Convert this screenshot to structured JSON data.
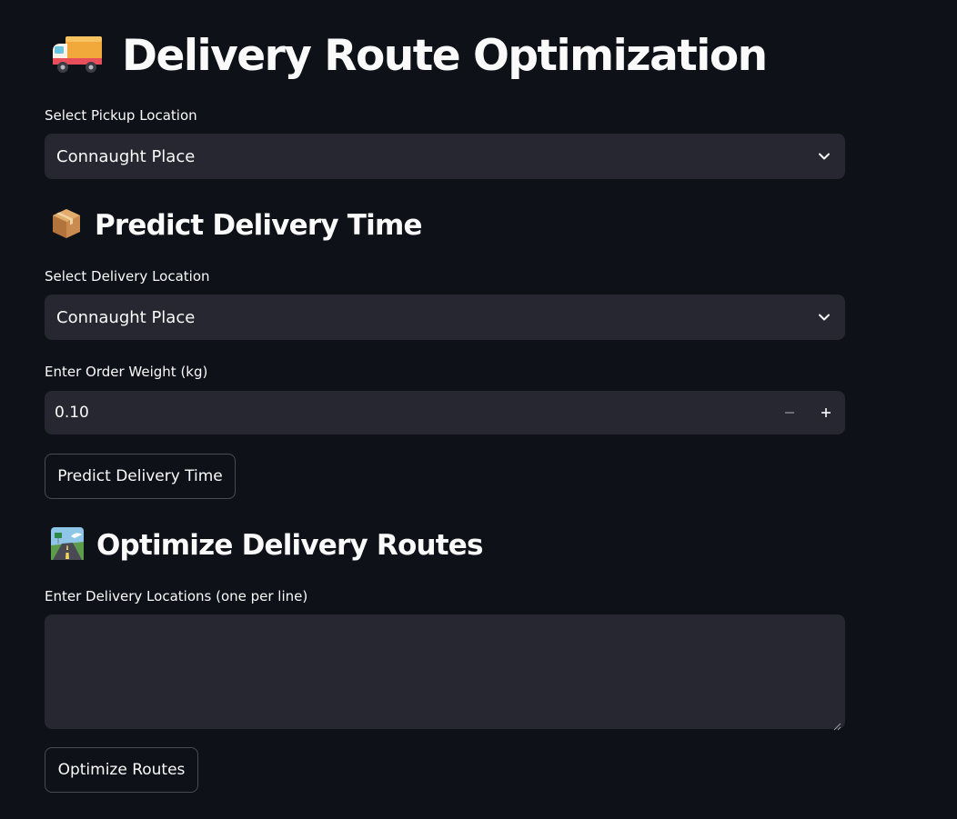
{
  "title": {
    "icon": "delivery-truck-icon",
    "text": "Delivery Route Optimization"
  },
  "pickup": {
    "label": "Select Pickup Location",
    "value": "Connaught Place",
    "icon": "chevron-down-icon"
  },
  "predict_section": {
    "icon": "package-box-icon",
    "heading": "Predict Delivery Time",
    "delivery_location": {
      "label": "Select Delivery Location",
      "value": "Connaught Place",
      "icon": "chevron-down-icon"
    },
    "weight": {
      "label": "Enter Order Weight (kg)",
      "value": "0.10",
      "decrement_icon": "minus-icon",
      "increment_icon": "plus-icon"
    },
    "button_label": "Predict Delivery Time"
  },
  "optimize_section": {
    "icon": "motorway-icon",
    "heading": "Optimize Delivery Routes",
    "locations": {
      "label": "Enter Delivery Locations (one per line)",
      "value": ""
    },
    "button_label": "Optimize Routes"
  },
  "colors": {
    "background": "#0e1117",
    "input_background": "#262730",
    "text": "#fafafa",
    "button_border": "rgba(250,250,250,0.25)"
  }
}
